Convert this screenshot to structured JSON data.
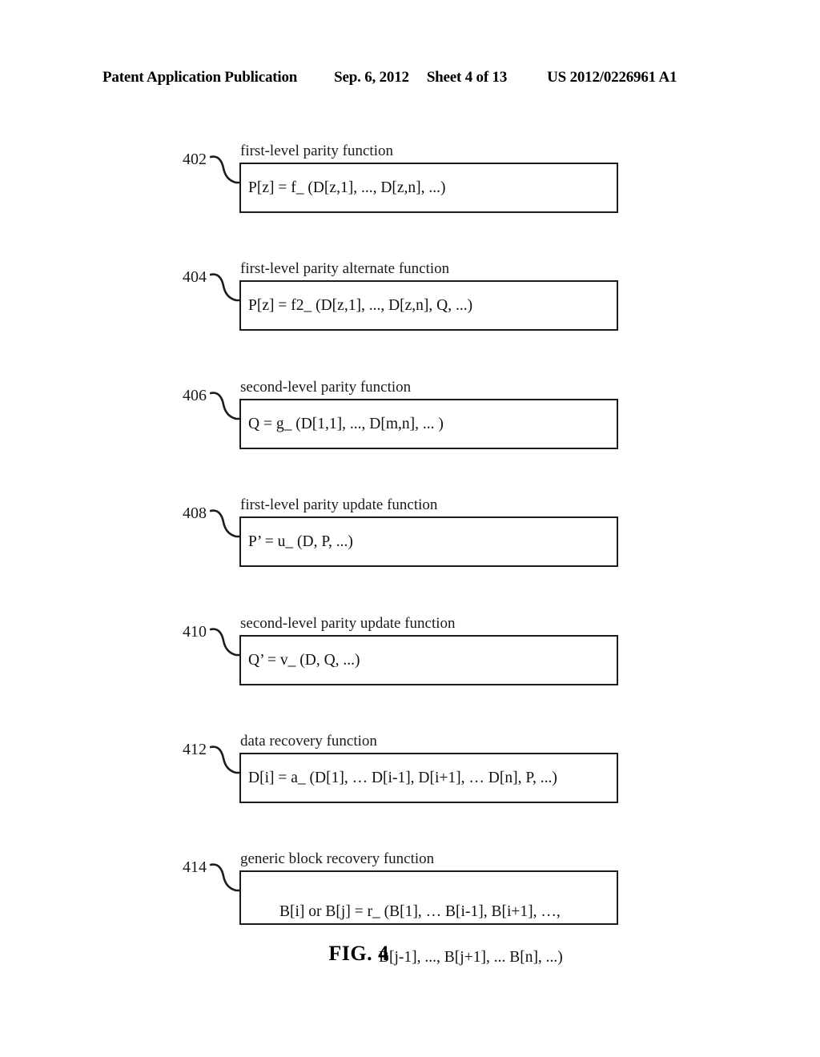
{
  "header": {
    "publication": "Patent Application Publication",
    "date": "Sep. 6, 2012",
    "sheet": "Sheet 4 of 13",
    "patent_number": "US 2012/0226961 A1"
  },
  "figure": {
    "label": "FIG. 4",
    "blocks": [
      {
        "ref": "402",
        "caption": "first-level parity function",
        "formula_line1": "P[z] = f_ (D[z,1], ..., D[z,n], ...)",
        "formula_line2": ""
      },
      {
        "ref": "404",
        "caption": "first-level parity alternate function",
        "formula_line1": "P[z] = f2_ (D[z,1], ..., D[z,n], Q, ...)",
        "formula_line2": ""
      },
      {
        "ref": "406",
        "caption": "second-level parity function",
        "formula_line1": "Q = g_ (D[1,1], ..., D[m,n], ... )",
        "formula_line2": ""
      },
      {
        "ref": "408",
        "caption": "first-level parity update function",
        "formula_line1": "P’ = u_ (D, P, ...)",
        "formula_line2": ""
      },
      {
        "ref": "410",
        "caption": "second-level parity update function",
        "formula_line1": "Q’ = v_ (D, Q, ...)",
        "formula_line2": ""
      },
      {
        "ref": "412",
        "caption": "data recovery function",
        "formula_line1": "D[i] = a_ (D[1], … D[i-1], D[i+1], … D[n], P, ...)",
        "formula_line2": ""
      },
      {
        "ref": "414",
        "caption": "generic block recovery function",
        "formula_line1": "B[i] or B[j] = r_ (B[1], … B[i-1], B[i+1], …,",
        "formula_line2": "B[j-1], ..., B[j+1], ... B[n], ...)"
      }
    ]
  }
}
